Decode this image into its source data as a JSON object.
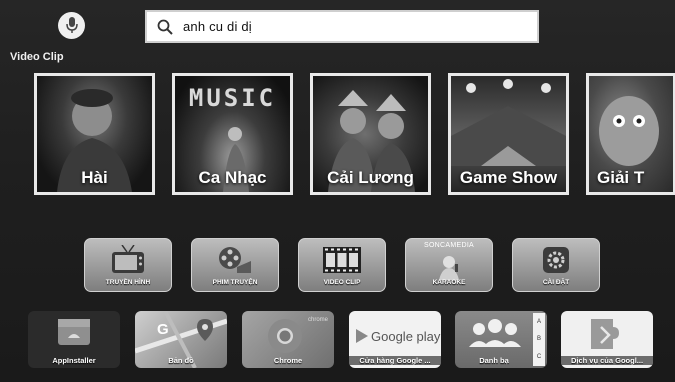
{
  "header": {
    "mic_icon": "microphone-icon",
    "search_icon": "search-icon",
    "search_value": "anh cu di dị"
  },
  "section_label": "Video Clip",
  "categories": [
    {
      "label": "Hài"
    },
    {
      "label": "Ca Nhạc",
      "art_text": "MUSIC"
    },
    {
      "label": "Cải Lương"
    },
    {
      "label": "Game Show"
    },
    {
      "label": "Giải T"
    }
  ],
  "apps": [
    {
      "label": "TRUYỀN HÌNH",
      "icon": "tv-icon"
    },
    {
      "label": "PHIM TRUYỆN",
      "icon": "film-reel-icon"
    },
    {
      "label": "VIDEO CLIP",
      "icon": "film-strip-icon"
    },
    {
      "label": "KARAOKE",
      "icon": "microphone-singer-icon",
      "brand": "SONCAMEDIA"
    },
    {
      "label": "CÀI ĐẶT",
      "icon": "settings-icon"
    }
  ],
  "bottom_apps": [
    {
      "label": "AppInstaller",
      "icon": "android-box-icon"
    },
    {
      "label": "Bản đồ",
      "icon": "maps-icon",
      "art_text": "G"
    },
    {
      "label": "Chrome",
      "icon": "chrome-icon",
      "art_text": "chrome"
    },
    {
      "label": "Cửa hàng Google ...",
      "icon": "play-store-icon",
      "art_text": "Google play"
    },
    {
      "label": "Danh bạ",
      "icon": "contacts-icon",
      "index_letters": [
        "A",
        "B",
        "C"
      ]
    },
    {
      "label": "Dịch vụ của Googl...",
      "icon": "puzzle-icon"
    }
  ]
}
